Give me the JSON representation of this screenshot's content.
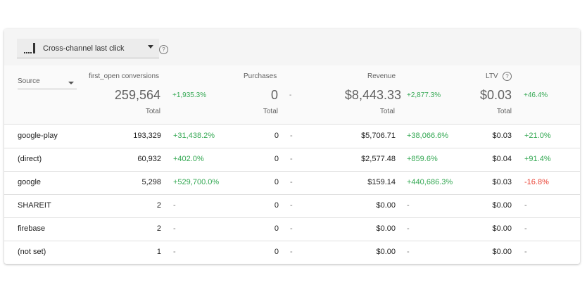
{
  "toolbar": {
    "attribution_model": "Cross-channel last click",
    "help_icon": "help-circle-icon"
  },
  "header": {
    "dimension_label": "Source",
    "columns": [
      {
        "title": "first_open conversions",
        "total": "259,564",
        "delta": "+1,935.3%",
        "total_label": "Total"
      },
      {
        "title": "Purchases",
        "total": "0",
        "delta": "-",
        "total_label": "Total"
      },
      {
        "title": "Revenue",
        "total": "$8,443.33",
        "delta": "+2,877.3%",
        "total_label": "Total"
      },
      {
        "title": "LTV",
        "total": "$0.03",
        "delta": "+46.4%",
        "total_label": "Total"
      }
    ]
  },
  "rows": [
    {
      "source": "google-play",
      "first_open": "193,329",
      "first_open_delta": "+31,438.2%",
      "purchases": "0",
      "purchases_delta": "-",
      "revenue": "$5,706.71",
      "revenue_delta": "+38,066.6%",
      "ltv": "$0.03",
      "ltv_delta": "+21.0%"
    },
    {
      "source": "(direct)",
      "first_open": "60,932",
      "first_open_delta": "+402.0%",
      "purchases": "0",
      "purchases_delta": "-",
      "revenue": "$2,577.48",
      "revenue_delta": "+859.6%",
      "ltv": "$0.04",
      "ltv_delta": "+91.4%"
    },
    {
      "source": "google",
      "first_open": "5,298",
      "first_open_delta": "+529,700.0%",
      "purchases": "0",
      "purchases_delta": "-",
      "revenue": "$159.14",
      "revenue_delta": "+440,686.3%",
      "ltv": "$0.03",
      "ltv_delta": "-16.8%"
    },
    {
      "source": "SHAREIT",
      "first_open": "2",
      "first_open_delta": "-",
      "purchases": "0",
      "purchases_delta": "-",
      "revenue": "$0.00",
      "revenue_delta": "-",
      "ltv": "$0.00",
      "ltv_delta": "-"
    },
    {
      "source": "firebase",
      "first_open": "2",
      "first_open_delta": "-",
      "purchases": "0",
      "purchases_delta": "-",
      "revenue": "$0.00",
      "revenue_delta": "-",
      "ltv": "$0.00",
      "ltv_delta": "-"
    },
    {
      "source": "(not set)",
      "first_open": "1",
      "first_open_delta": "-",
      "purchases": "0",
      "purchases_delta": "-",
      "revenue": "$0.00",
      "revenue_delta": "-",
      "ltv": "$0.00",
      "ltv_delta": "-"
    }
  ],
  "colors": {
    "positive": "#34a853",
    "negative": "#ea4335",
    "neutral": "#757575"
  }
}
